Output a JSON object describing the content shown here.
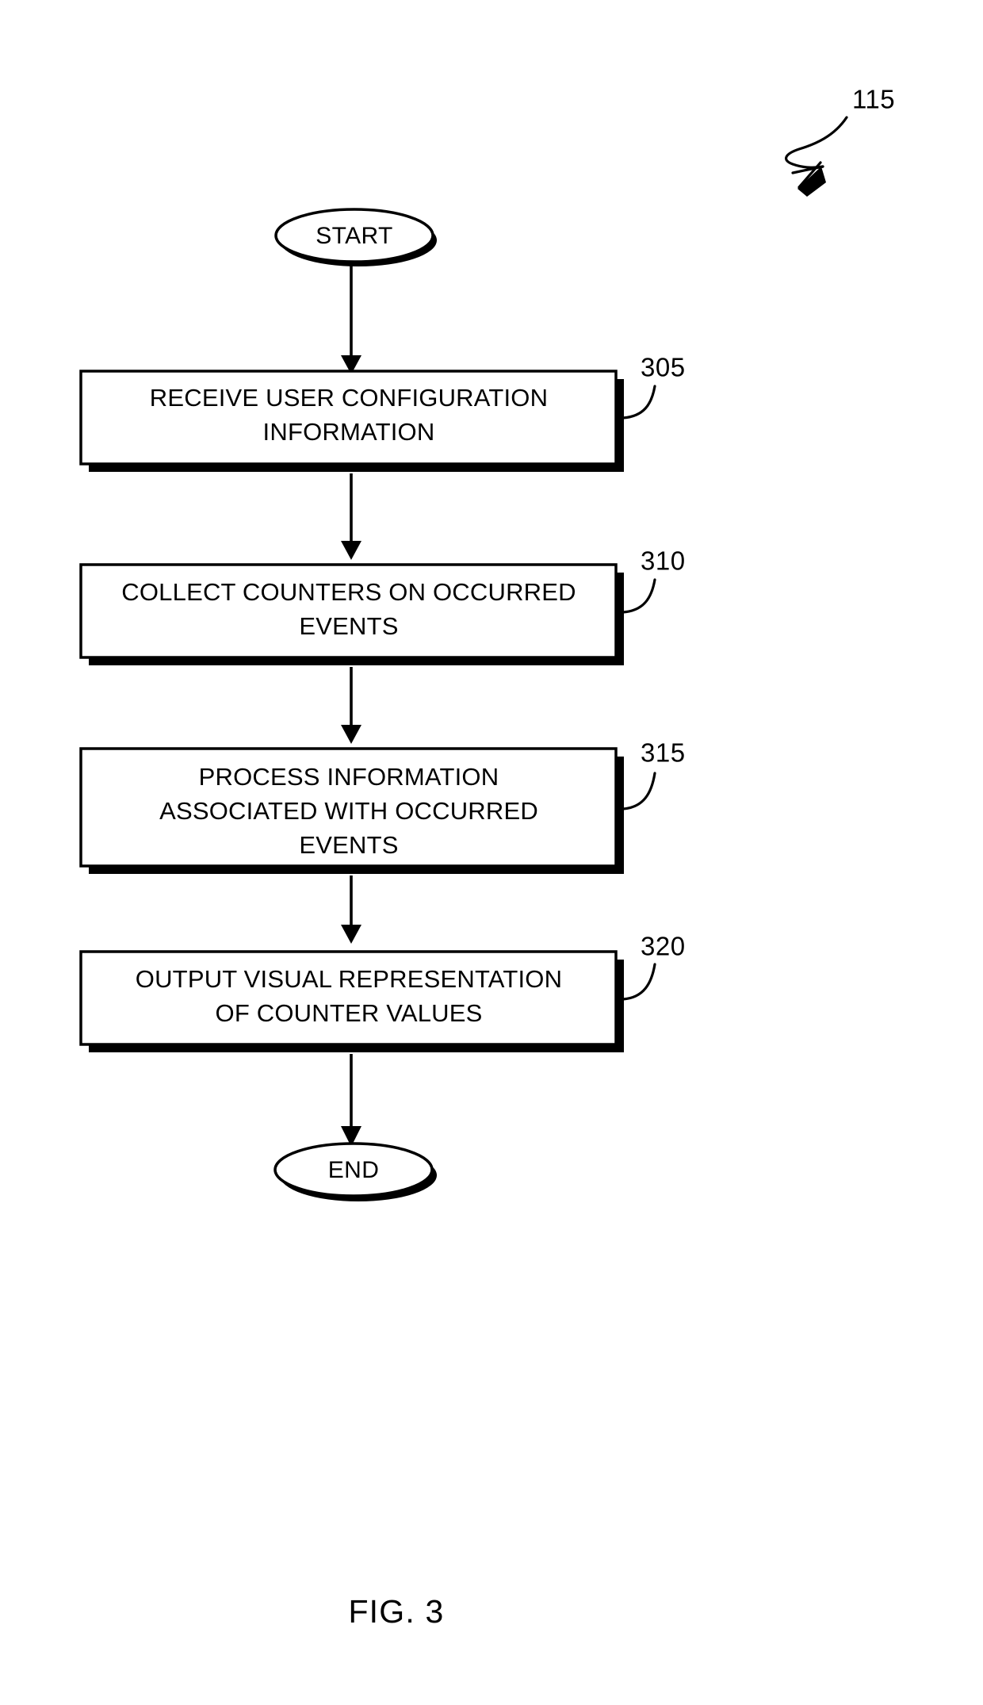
{
  "figure": {
    "caption": "FIG. 3",
    "top_reference": "115"
  },
  "nodes": {
    "start": {
      "label": "START",
      "shape": "oval"
    },
    "end": {
      "label": "END",
      "shape": "oval"
    },
    "step_305": {
      "reference": "305",
      "shape": "process",
      "lines": [
        "RECEIVE USER CONFIGURATION",
        "INFORMATION"
      ]
    },
    "step_310": {
      "reference": "310",
      "shape": "process",
      "lines": [
        "COLLECT COUNTERS ON OCCURRED",
        "EVENTS"
      ]
    },
    "step_315": {
      "reference": "315",
      "shape": "process",
      "lines": [
        "PROCESS INFORMATION",
        "ASSOCIATED WITH OCCURRED",
        "EVENTS"
      ]
    },
    "step_320": {
      "reference": "320",
      "shape": "process",
      "lines": [
        "OUTPUT VISUAL REPRESENTATION",
        "OF COUNTER VALUES"
      ]
    }
  },
  "colors": {
    "ink": "#000000",
    "paper": "#ffffff"
  }
}
